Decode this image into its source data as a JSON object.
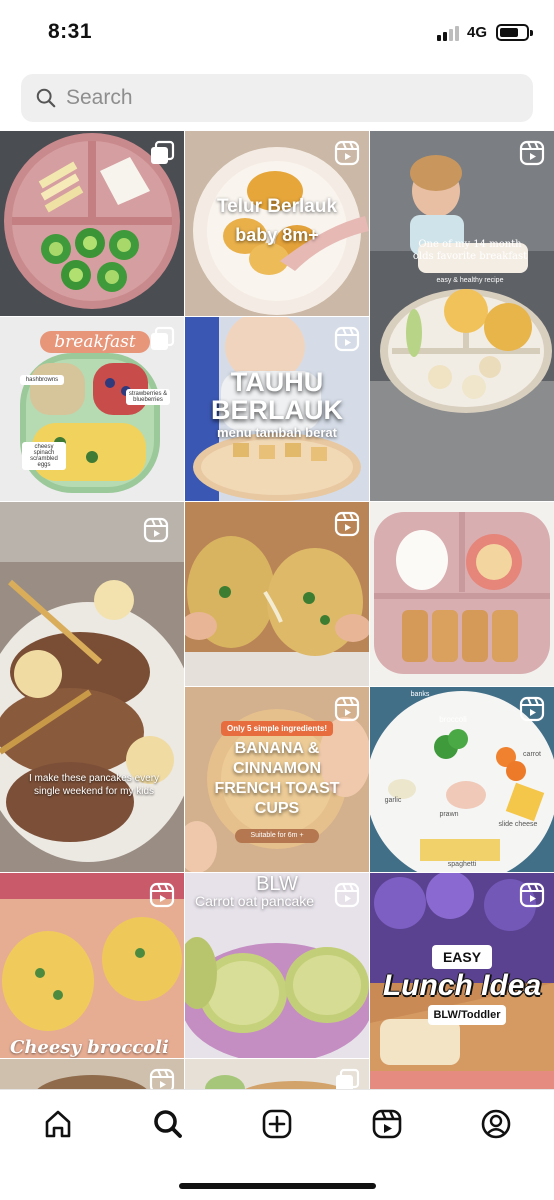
{
  "status_bar": {
    "time": "8:31",
    "network": "4G",
    "icons": [
      "signal-icon",
      "battery-icon"
    ]
  },
  "search": {
    "placeholder": "Search",
    "value": ""
  },
  "grid": {
    "tiles": [
      {
        "kind": "carousel",
        "caption": ""
      },
      {
        "kind": "reel",
        "caption": "Telur Berlauk",
        "caption2": "baby 8m+"
      },
      {
        "kind": "reel",
        "caption": "One of my 14 month olds favorite breakfast",
        "caption2": "easy & healthy recipe"
      },
      {
        "kind": "carousel",
        "caption": "breakfast",
        "labels": [
          "hashbrowns",
          "strawberries & blueberries",
          "cheesy spinach scrambled eggs"
        ]
      },
      {
        "kind": "reel",
        "caption": "TAUHU",
        "caption2": "BERLAUK",
        "caption3": "menu tambah berat"
      },
      {
        "kind": "reel",
        "caption": "I make these pancakes every single weekend for my kids"
      },
      {
        "kind": "reel",
        "caption": ""
      },
      {
        "kind": "post",
        "caption": ""
      },
      {
        "kind": "reel",
        "caption": "Only 5 simple ingredients!",
        "caption2": "BANANA & CINNAMON FRENCH TOAST CUPS",
        "caption3": "Suitable for 6m +"
      },
      {
        "kind": "reel",
        "labels": [
          "banks",
          "broccoli",
          "carrot",
          "garlic",
          "prawn",
          "slide cheese",
          "spaghetti"
        ]
      },
      {
        "kind": "reel",
        "caption": "Cheesy broccoli"
      },
      {
        "kind": "reel",
        "caption": "BLW",
        "caption2": "Carrot oat pancake"
      },
      {
        "kind": "reel",
        "caption": "EASY",
        "caption2": "Lunch Idea",
        "caption3": "BLW/Toddler"
      },
      {
        "kind": "reel",
        "caption": ""
      },
      {
        "kind": "carousel",
        "caption": ""
      }
    ]
  },
  "nav": {
    "items": [
      "home-icon",
      "search-icon",
      "create-icon",
      "reels-icon",
      "profile-icon"
    ],
    "active": "search-icon"
  }
}
